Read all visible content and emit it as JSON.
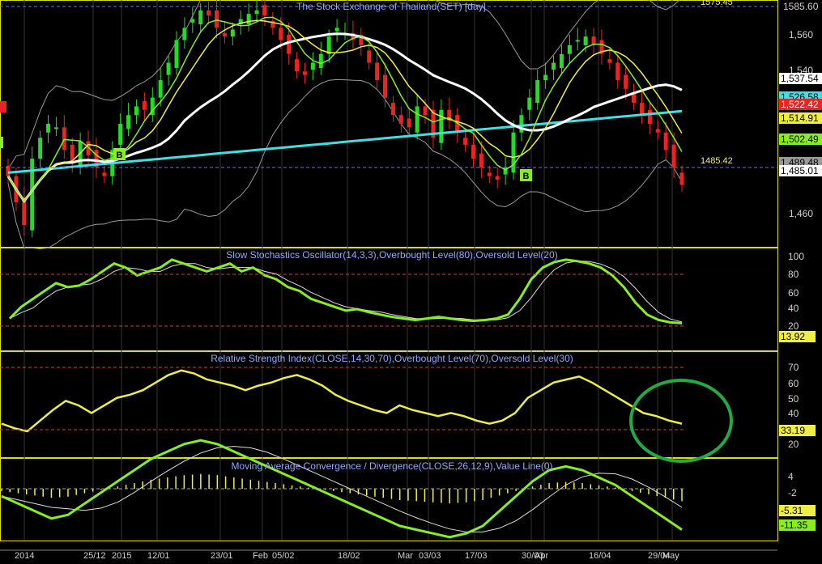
{
  "colors": {
    "background": "#000000",
    "grid": "#3a3a3a",
    "panel_border": "#e0e000",
    "title": "#8fa8ff",
    "axis_text": "#cfcfcf",
    "up_candle": "#22dd22",
    "down_candle": "#ee2222",
    "sma_white": "#ffffff",
    "sma_cyan": "#3fdfe6",
    "ema_yellow": "#eeee44",
    "ema_green": "#88ee22",
    "bollinger": "#9a9a9a",
    "level_line": "#cc4444",
    "dotted_level": "#6a6aff",
    "highlight_circle": "#22aa44"
  },
  "price_panel": {
    "title": "The Stock Exchange of Thailand(SET) [day]",
    "y_ticks": [
      "1,560",
      "1,540",
      "1,460"
    ],
    "labels_top": "1585.60",
    "dotted_top_label": "1575.45",
    "dotted_bottom_label": "1485.42",
    "right_tags": [
      {
        "text": "1,537.54",
        "bg": "#ffffff",
        "fg": "#000000"
      },
      {
        "text": "1,526.58",
        "bg": "#3fdfe6",
        "fg": "#000000"
      },
      {
        "text": "1,522.42",
        "bg": "#ee2222",
        "fg": "#ffffff"
      },
      {
        "text": "1,514.91",
        "bg": "#eeee44",
        "fg": "#000000"
      },
      {
        "text": "1,502.49",
        "bg": "#88ee22",
        "fg": "#000000"
      },
      {
        "text": "1,489.48",
        "bg": "#9a9a9a",
        "fg": "#000000"
      },
      {
        "text": "1,485.01",
        "bg": "#ffffff",
        "fg": "#000000"
      }
    ],
    "markers": [
      "B",
      "B"
    ]
  },
  "stoch_panel": {
    "title": "Slow Stochastics Oscillator(14,3,3),Overbought Level(80),Oversold Level(20)",
    "y_ticks": [
      "100",
      "80",
      "60",
      "40",
      "20"
    ],
    "value_tag": "13.92"
  },
  "rsi_panel": {
    "title": "Relative Strength Index(CLOSE,14,30,70),Overbought Level(70),Oversold Level(30)",
    "y_ticks": [
      "70",
      "60",
      "50",
      "40",
      "20"
    ],
    "value_tag": "33.19"
  },
  "macd_panel": {
    "title": "Moving Average Convergence / Divergence(CLOSE,26,12,9),Value Line(0)",
    "y_ticks": [
      "4",
      "-2"
    ],
    "value_tags": [
      "-5.31",
      "-11.35"
    ]
  },
  "x_axis": {
    "labels": [
      "2014",
      "25/12",
      "2015",
      "12/01",
      "23/01",
      "Feb",
      "05/02",
      "18/02",
      "Mar",
      "03/03",
      "17/03",
      "30/03",
      "Apr",
      "16/04",
      "29/04",
      "May"
    ]
  },
  "chart_data": {
    "type": "line",
    "title": "The Stock Exchange of Thailand(SET) [day]",
    "series": [
      {
        "name": "Price close",
        "values": [
          1490,
          1475,
          1462,
          1500,
          1512,
          1520,
          1518,
          1505,
          1498,
          1510,
          1502,
          1495,
          1490,
          1505,
          1520,
          1525,
          1530,
          1528,
          1535,
          1545,
          1555,
          1568,
          1575,
          1580,
          1585,
          1582,
          1575,
          1570,
          1574,
          1580,
          1583,
          1585,
          1582,
          1575,
          1568,
          1560,
          1550,
          1548,
          1555,
          1560,
          1570,
          1575,
          1572,
          1568,
          1565,
          1555,
          1545,
          1535,
          1525,
          1520,
          1518,
          1530,
          1525,
          1512,
          1528,
          1522,
          1515,
          1508,
          1500,
          1495,
          1490,
          1488,
          1495,
          1515,
          1525,
          1535,
          1545,
          1548,
          1555,
          1560,
          1565,
          1568,
          1570,
          1565,
          1560,
          1555,
          1545,
          1540,
          1532,
          1525,
          1520,
          1515,
          1505,
          1495,
          1485
        ]
      },
      {
        "name": "Stochastic",
        "values": [
          20,
          35,
          45,
          55,
          65,
          60,
          62,
          70,
          80,
          90,
          85,
          75,
          80,
          85,
          95,
          90,
          85,
          80,
          85,
          90,
          80,
          85,
          75,
          70,
          60,
          55,
          45,
          40,
          35,
          30,
          32,
          28,
          25,
          22,
          20,
          18,
          20,
          22,
          20,
          18,
          17,
          18,
          20,
          25,
          45,
          70,
          85,
          92,
          95,
          93,
          90,
          85,
          75,
          60,
          40,
          25,
          18,
          15,
          14
        ]
      },
      {
        "name": "RSI",
        "values": [
          33,
          30,
          28,
          35,
          42,
          48,
          45,
          40,
          45,
          50,
          52,
          55,
          60,
          65,
          68,
          66,
          62,
          60,
          58,
          55,
          58,
          60,
          63,
          65,
          62,
          58,
          52,
          48,
          45,
          42,
          40,
          45,
          42,
          40,
          38,
          40,
          38,
          35,
          33,
          35,
          40,
          50,
          55,
          60,
          62,
          64,
          60,
          55,
          50,
          45,
          40,
          38,
          35,
          33
        ]
      },
      {
        "name": "MACD",
        "values": [
          -2,
          -4,
          -6,
          -8,
          -7,
          -4,
          -1,
          2,
          5,
          8,
          10,
          12,
          13,
          12,
          10,
          8,
          6,
          4,
          2,
          0,
          -2,
          -4,
          -6,
          -8,
          -10,
          -11,
          -12,
          -13,
          -12,
          -10,
          -6,
          -2,
          2,
          5,
          6,
          5,
          3,
          1,
          -2,
          -5,
          -8,
          -11
        ]
      }
    ]
  }
}
